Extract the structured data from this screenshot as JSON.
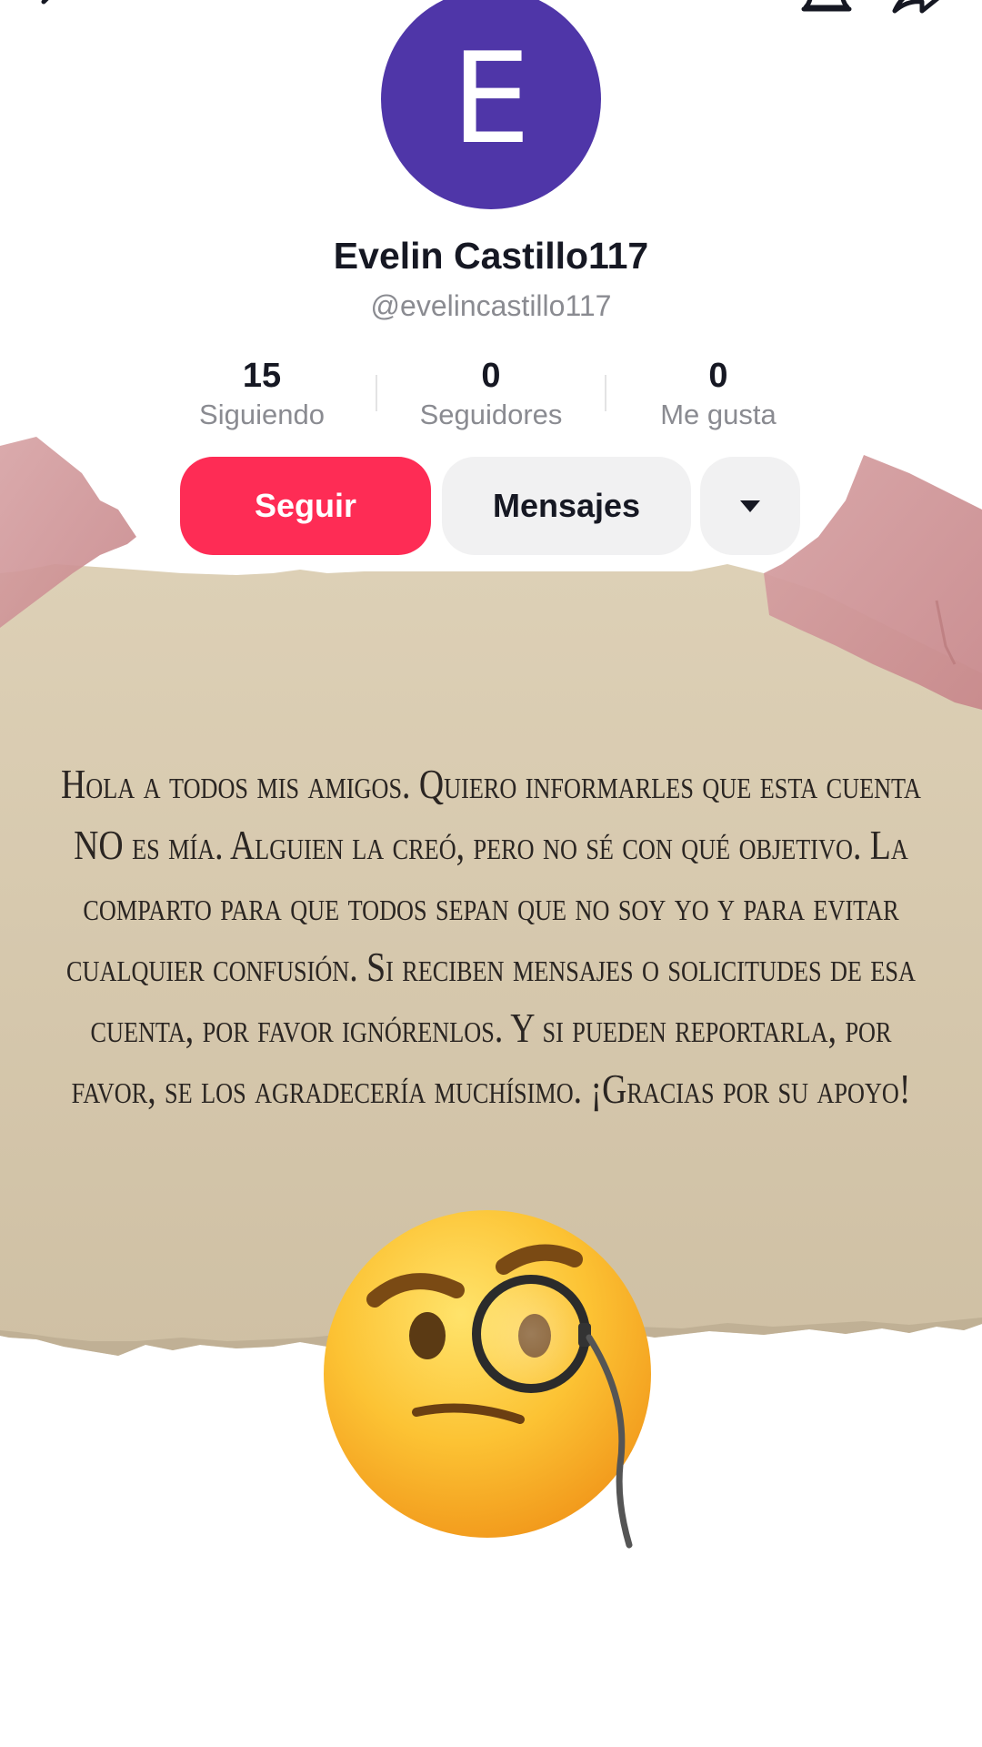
{
  "profile": {
    "avatar_letter": "E",
    "avatar_color": "#4f36a8",
    "display_name": "Evelin Castillo117",
    "username": "@evelincastillo117"
  },
  "stats": [
    {
      "value": "15",
      "label": "Siguiendo"
    },
    {
      "value": "0",
      "label": "Seguidores"
    },
    {
      "value": "0",
      "label": "Me gusta"
    }
  ],
  "actions": {
    "follow_label": "Seguir",
    "follow_color": "#fe2c55",
    "message_label": "Mensajes"
  },
  "top_bar": {
    "icons": [
      "back-icon",
      "bell-icon",
      "share-icon"
    ]
  },
  "post": {
    "message_lines": [
      "Hola a todos mis amigos. Quiero informarles que esta cuenta",
      "NO es mía. Alguien la creó, pero no sé con qué objetivo. La",
      "comparto para que todos sepan que no soy yo y para evitar",
      "cualquier confusión. Si reciben mensajes o solicitudes de esa",
      "cuenta, por favor ignórenlos. Y si pueden reportarla, por",
      "favor, se los agradecería muchísimo. ¡Gracias por su apoyo!"
    ],
    "emoji": "face-with-monocle"
  }
}
